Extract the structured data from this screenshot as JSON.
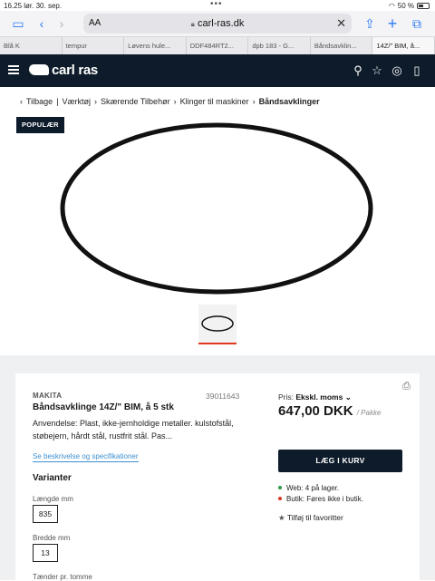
{
  "status": {
    "time": "16.25",
    "date": "lør. 30. sep.",
    "battery": "50 %"
  },
  "browser": {
    "aa": "AA",
    "url": "carl-ras.dk"
  },
  "tabs": [
    {
      "icon": "star",
      "label": "Blå K"
    },
    {
      "icon": "G",
      "label": "tempur"
    },
    {
      "icon": "KR",
      "label": "Løvens hule..."
    },
    {
      "icon": "G",
      "label": "DDF484RT2..."
    },
    {
      "icon": "G",
      "label": "dpb 183 - G..."
    },
    {
      "icon": "W",
      "label": "Båndsavklin..."
    },
    {
      "icon": "x",
      "label": "14Z/\" BIM, å..."
    }
  ],
  "site": {
    "logo": "carl ras"
  },
  "breadcrumb": [
    "Tilbage",
    "Værktøj",
    "Skærende Tilbehør",
    "Klinger til maskiner",
    "Båndsavklinger"
  ],
  "badge": "POPULÆR",
  "product": {
    "brand": "MAKITA",
    "sku": "39011643",
    "title": "Båndsavklinge 14Z/\" BIM, å 5 stk",
    "description": "Anvendelse: Plast, ikke-jernholdige metaller. kulstofstål, støbejern, hårdt stål, rustfrit stål. Pas...",
    "see_more": "Se beskrivelse og specifikationer",
    "variants_title": "Varianter",
    "variants": [
      {
        "label": "Længde mm",
        "value": "835"
      },
      {
        "label": "Bredde mm",
        "value": "13"
      },
      {
        "label": "Tænder pr. tomme",
        "value": ""
      }
    ]
  },
  "pricing": {
    "label": "Pris:",
    "mode": "Ekskl. moms",
    "price": "647,00 DKK",
    "unit": "/ Pakke",
    "cart_button": "LÆG I KURV",
    "stock_web": "Web: 4 på lager.",
    "stock_store": "Butik: Føres ikke i butik.",
    "favorite": "Tilføj til favoritter",
    "colors": {
      "web": "#2e9b47",
      "store": "#d9362b"
    }
  },
  "colors": {
    "brand_dark": "#0d1b2a",
    "accent_red": "#e0381d",
    "link": "#3e8fd0"
  }
}
